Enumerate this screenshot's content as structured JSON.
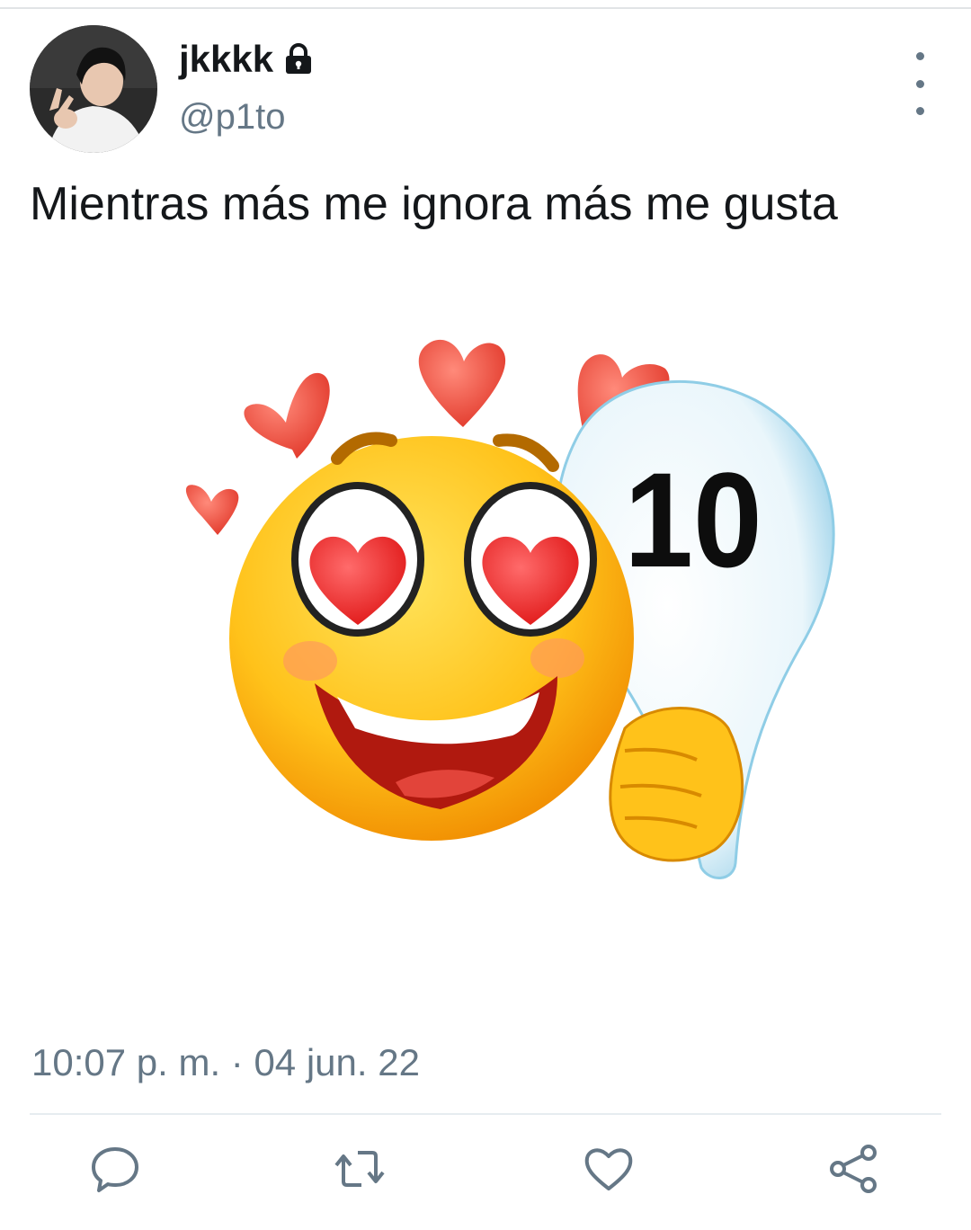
{
  "user": {
    "display_name": "jkkkk",
    "handle": "@p1to",
    "protected": true
  },
  "tweet": {
    "text": "Mientras más me ignora más me gusta",
    "timestamp": "10:07 p. m. · 04 jun. 22",
    "media": {
      "sign_number": "10"
    }
  },
  "actions": [
    "reply-icon",
    "retweet-icon",
    "like-icon",
    "share-icon"
  ],
  "colors": {
    "text_primary": "#14171a",
    "text_secondary": "#657786",
    "icon": "#657786",
    "heart_red": "#ef4b3a",
    "emoji_yellow": "#ffc21a"
  }
}
